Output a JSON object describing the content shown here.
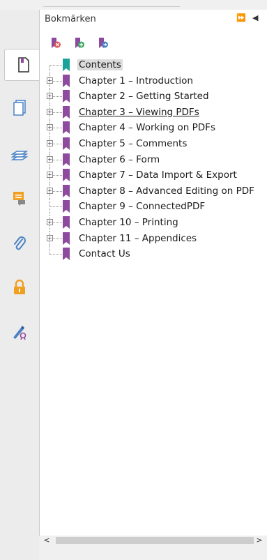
{
  "panel": {
    "title": "Bokmärken",
    "collapse_label": "⏩",
    "options_label": "◀"
  },
  "toolbar": {
    "delete_icon": "bookmark-delete-icon",
    "expand_icon": "bookmark-expand-icon",
    "find_icon": "bookmark-find-icon"
  },
  "rail": {
    "tabs": [
      {
        "name": "bookmarks-tab",
        "icon": "page-icon",
        "active": true
      },
      {
        "name": "pages-tab",
        "icon": "pages-icon",
        "active": false
      },
      {
        "name": "layers-tab",
        "icon": "layers-icon",
        "active": false
      },
      {
        "name": "comments-tab",
        "icon": "comment-icon",
        "active": false
      },
      {
        "name": "attachments-tab",
        "icon": "paperclip-icon",
        "active": false
      },
      {
        "name": "security-tab",
        "icon": "lock-icon",
        "active": false
      },
      {
        "name": "signatures-tab",
        "icon": "signature-icon",
        "active": false
      }
    ]
  },
  "bookmarks": [
    {
      "label": "Contents",
      "expandable": false,
      "selected": true,
      "color": "#1aa398"
    },
    {
      "label": "Chapter 1 – Introduction",
      "expandable": true
    },
    {
      "label": "Chapter 2 – Getting Started",
      "expandable": true
    },
    {
      "label": "Chapter 3 – Viewing PDFs",
      "expandable": true,
      "underlined": true
    },
    {
      "label": "Chapter 4 – Working on PDFs",
      "expandable": true
    },
    {
      "label": "Chapter 5 – Comments",
      "expandable": true
    },
    {
      "label": "Chapter 6 – Form",
      "expandable": true
    },
    {
      "label": "Chapter 7 – Data Import & Export",
      "expandable": true
    },
    {
      "label": "Chapter 8 – Advanced Editing on PDF",
      "expandable": true
    },
    {
      "label": "Chapter 9 – ConnectedPDF",
      "expandable": false
    },
    {
      "label": "Chapter 10 – Printing",
      "expandable": true
    },
    {
      "label": "Chapter 11 – Appendices",
      "expandable": true
    },
    {
      "label": "Contact Us",
      "expandable": false
    }
  ],
  "colors": {
    "bookmark_purple": "#8e4a9e",
    "bookmark_teal": "#1aa398",
    "rail_blue": "#4a82c4",
    "rail_orange": "#f0a020"
  },
  "scrollbar": {
    "left_arrow": "<",
    "right_arrow": ">"
  }
}
